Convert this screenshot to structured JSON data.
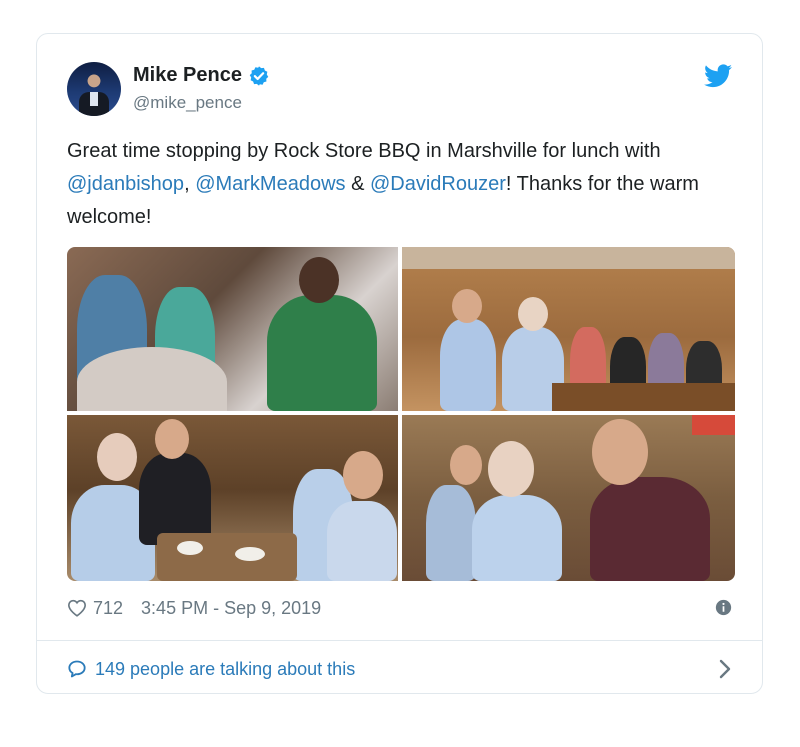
{
  "tweet": {
    "author_name": "Mike Pence",
    "author_handle": "@mike_pence",
    "text_part1": "Great time stopping by Rock Store BBQ in Marshville for lunch with ",
    "mention1": "@jdanbishop",
    "text_part2": ", ",
    "mention2": "@MarkMeadows",
    "text_part3": " & ",
    "mention3": "@DavidRouzer",
    "text_part4": "! Thanks for the warm welcome!",
    "likes": "712",
    "timestamp": "3:45 PM - Sep 9, 2019",
    "talking_label": "149 people are talking about this"
  },
  "icons": {
    "verified": "verified-badge-icon",
    "logo": "twitter-bird-icon",
    "like": "heart-icon",
    "info": "info-icon",
    "talk": "speech-bubble-icon",
    "more": "chevron-right-icon"
  },
  "colors": {
    "link": "#2b7bb9",
    "muted": "#697882",
    "twitter_blue": "#1da1f2",
    "border": "#e1e8ed"
  }
}
